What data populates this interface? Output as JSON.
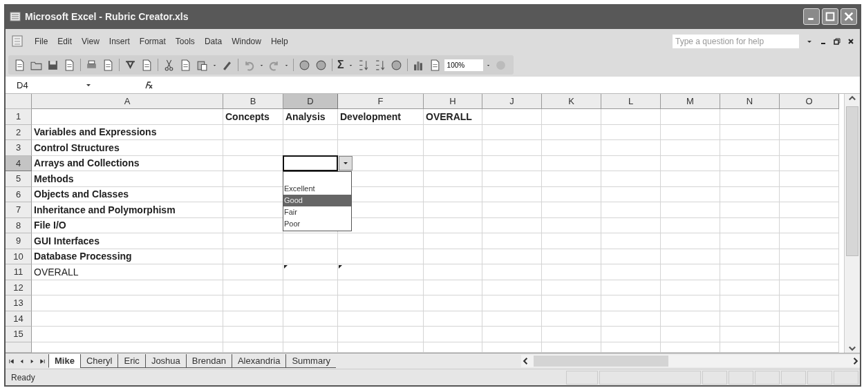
{
  "window": {
    "title": "Microsoft Excel - Rubric Creator.xls"
  },
  "menu": [
    {
      "label": "File"
    },
    {
      "label": "Edit"
    },
    {
      "label": "View"
    },
    {
      "label": "Insert"
    },
    {
      "label": "Format"
    },
    {
      "label": "Tools"
    },
    {
      "label": "Data"
    },
    {
      "label": "Window"
    },
    {
      "label": "Help"
    }
  ],
  "help_search": {
    "placeholder": "Type a question for help"
  },
  "toolbar": {
    "sum_symbol": "Σ",
    "zoom": "100%"
  },
  "formula_bar": {
    "name_box": "D4"
  },
  "columns": [
    {
      "label": "A",
      "selected": false
    },
    {
      "label": "B",
      "selected": false
    },
    {
      "label": "D",
      "selected": true
    },
    {
      "label": "F",
      "selected": false
    },
    {
      "label": "H",
      "selected": false
    },
    {
      "label": "J",
      "selected": false
    },
    {
      "label": "K",
      "selected": false
    },
    {
      "label": "L",
      "selected": false
    },
    {
      "label": "M",
      "selected": false
    },
    {
      "label": "N",
      "selected": false
    },
    {
      "label": "O",
      "selected": false
    }
  ],
  "rows": [
    {
      "number": "1",
      "selected": false,
      "bold": true,
      "cells": [
        "",
        "Concepts",
        "Analysis",
        "Development",
        "OVERALL"
      ]
    },
    {
      "number": "2",
      "selected": false,
      "bold": true,
      "cells": [
        "Variables and Expressions"
      ]
    },
    {
      "number": "3",
      "selected": false,
      "bold": true,
      "cells": [
        "Control Structures"
      ]
    },
    {
      "number": "4",
      "selected": true,
      "bold": true,
      "cells": [
        "Arrays and Collections"
      ]
    },
    {
      "number": "5",
      "selected": false,
      "bold": true,
      "cells": [
        "Methods"
      ]
    },
    {
      "number": "6",
      "selected": false,
      "bold": true,
      "cells": [
        "Objects and Classes"
      ]
    },
    {
      "number": "7",
      "selected": false,
      "bold": true,
      "cells": [
        "Inheritance and Polymorphism"
      ]
    },
    {
      "number": "8",
      "selected": false,
      "bold": true,
      "cells": [
        "File I/O"
      ]
    },
    {
      "number": "9",
      "selected": false,
      "bold": true,
      "cells": [
        "GUI Interfaces"
      ]
    },
    {
      "number": "10",
      "selected": false,
      "bold": true,
      "cells": [
        "Database Processing"
      ]
    },
    {
      "number": "11",
      "selected": false,
      "bold": false,
      "cells": [
        "OVERALL"
      ],
      "flags": [
        false,
        false,
        true,
        true
      ]
    },
    {
      "number": "12",
      "selected": false,
      "cells": []
    },
    {
      "number": "13",
      "selected": false,
      "cells": []
    },
    {
      "number": "14",
      "selected": false,
      "cells": []
    },
    {
      "number": "15",
      "selected": false,
      "cells": []
    }
  ],
  "dropdown": {
    "items": [
      {
        "label": "Excellent",
        "selected": false
      },
      {
        "label": "Good",
        "selected": true
      },
      {
        "label": "Fair",
        "selected": false
      },
      {
        "label": "Poor",
        "selected": false
      }
    ]
  },
  "sheet_tabs": [
    {
      "label": "Mike",
      "selected": true
    },
    {
      "label": "Cheryl",
      "selected": false
    },
    {
      "label": "Eric",
      "selected": false
    },
    {
      "label": "Joshua",
      "selected": false
    },
    {
      "label": "Brendan",
      "selected": false
    },
    {
      "label": "Alexandria",
      "selected": false
    },
    {
      "label": "Summary",
      "selected": false
    }
  ],
  "status_bar": {
    "text": "Ready"
  }
}
